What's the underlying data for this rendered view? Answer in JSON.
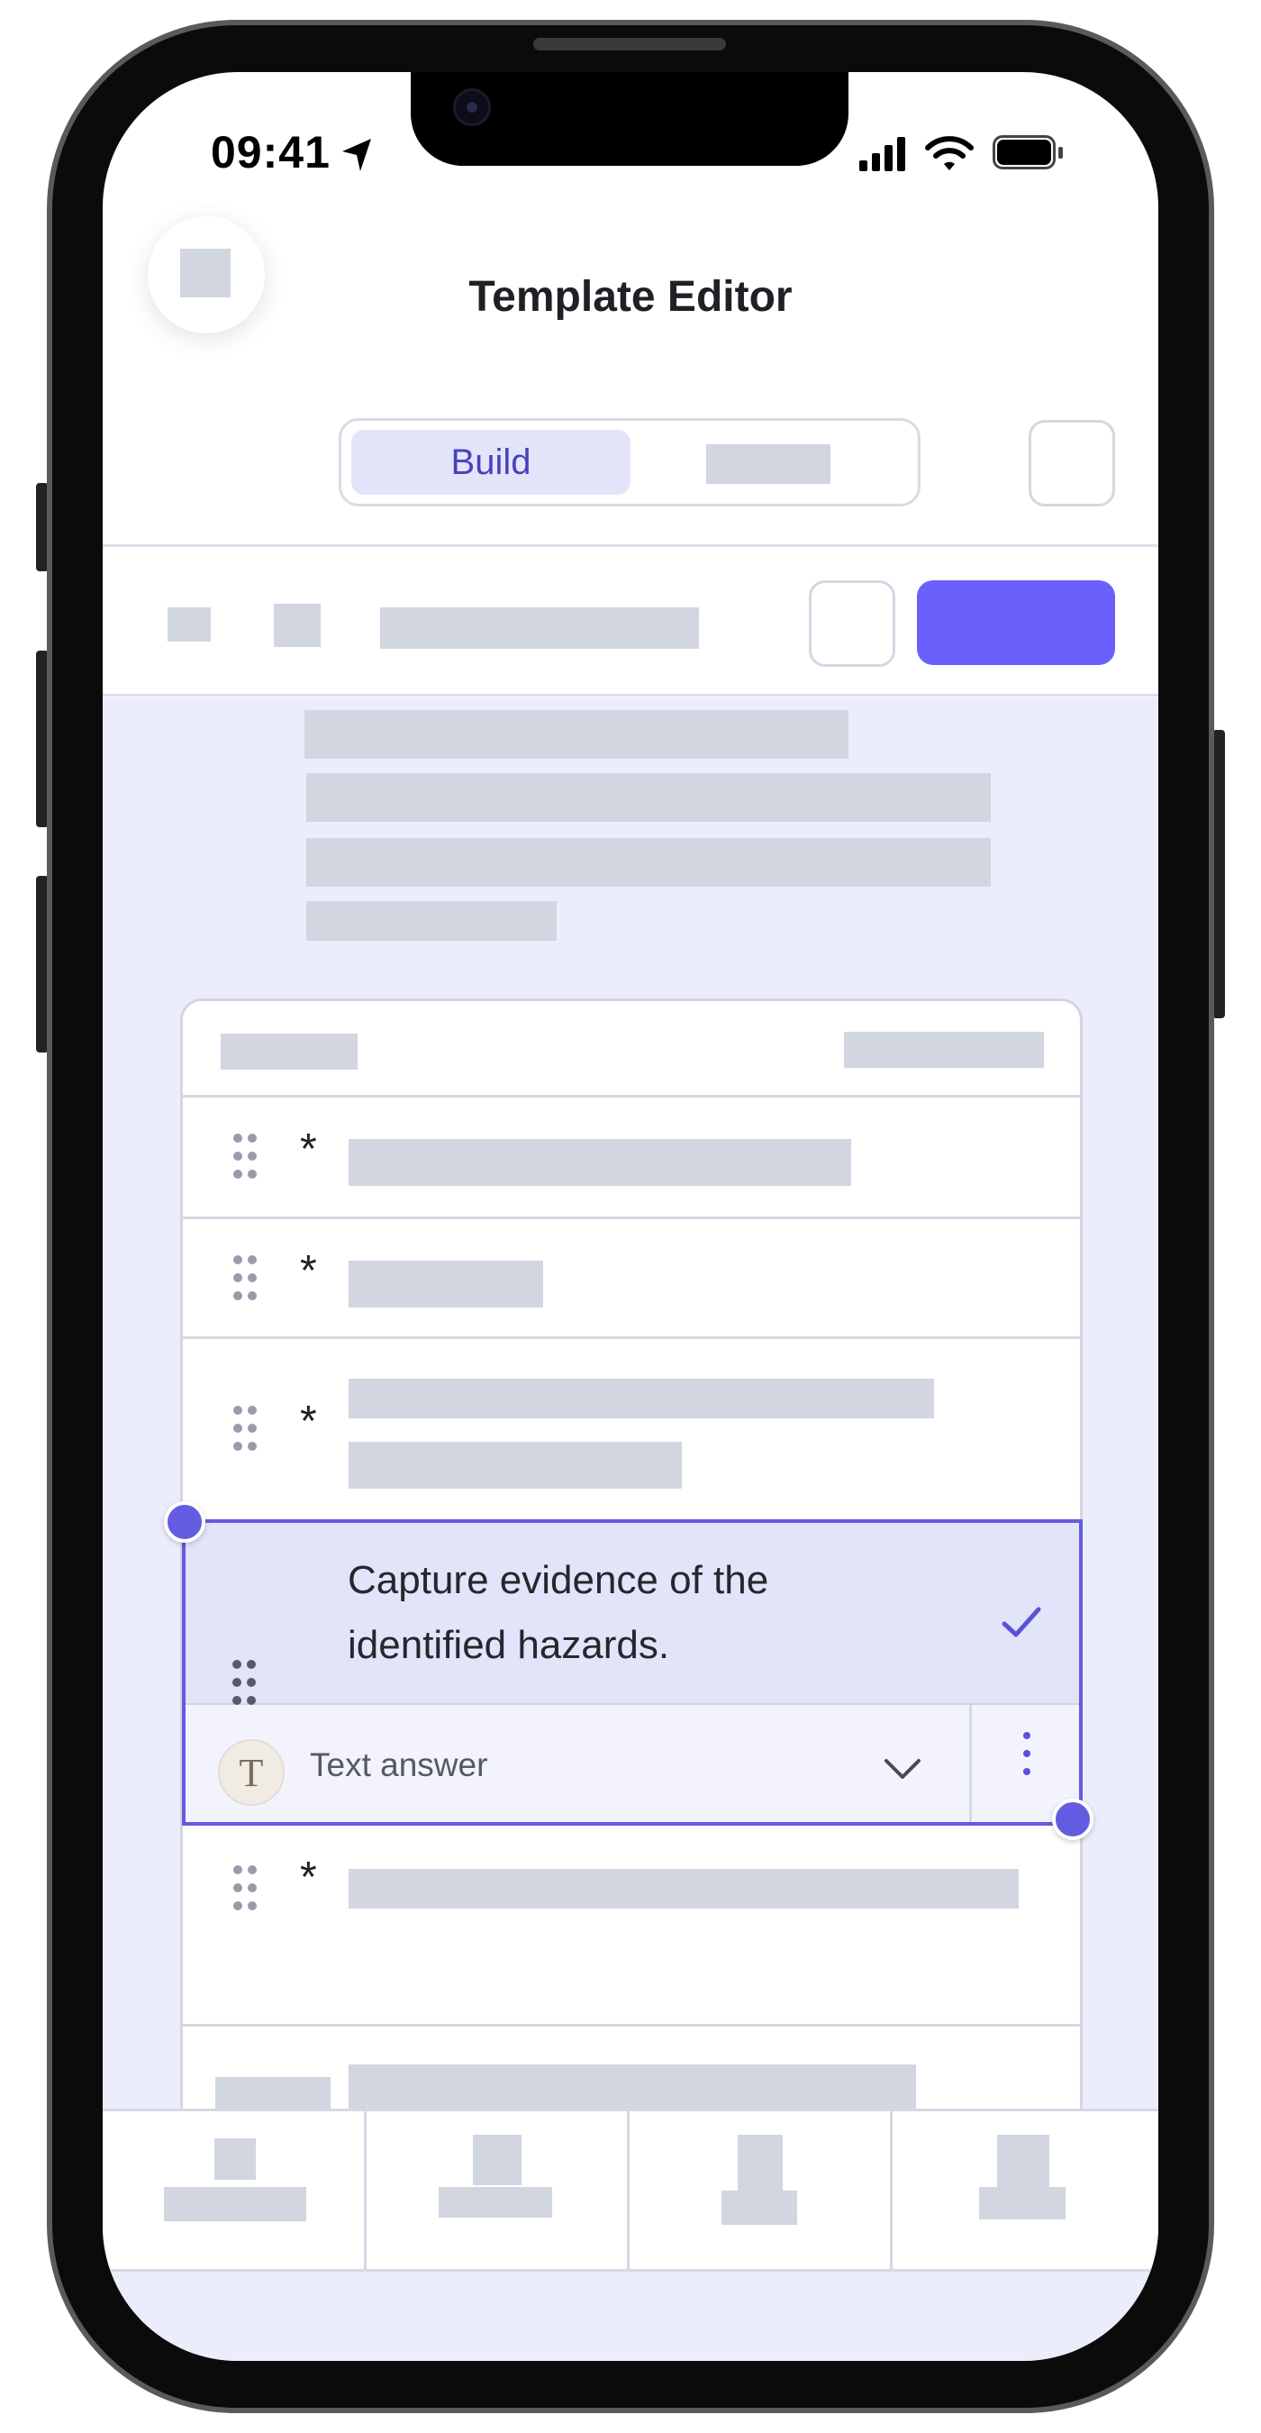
{
  "status_bar": {
    "time": "09:41"
  },
  "header": {
    "title": "Template Editor"
  },
  "mode_switch": {
    "active_label": "Build"
  },
  "selected_question": {
    "text": "Capture evidence of the identified hazards.",
    "answer_type_label": "Text answer",
    "answer_type_icon_letter": "T"
  },
  "question_rows": {
    "required_marker": "*"
  },
  "colors": {
    "accent": "#6a60fb",
    "selection": "#645ce0",
    "canvas": "#ebedfa"
  },
  "icons": [
    "location-arrow-icon",
    "signal-icon",
    "wifi-icon",
    "battery-icon",
    "drag-handle-icon",
    "check-icon",
    "chevron-down-icon",
    "more-vertical-icon"
  ]
}
